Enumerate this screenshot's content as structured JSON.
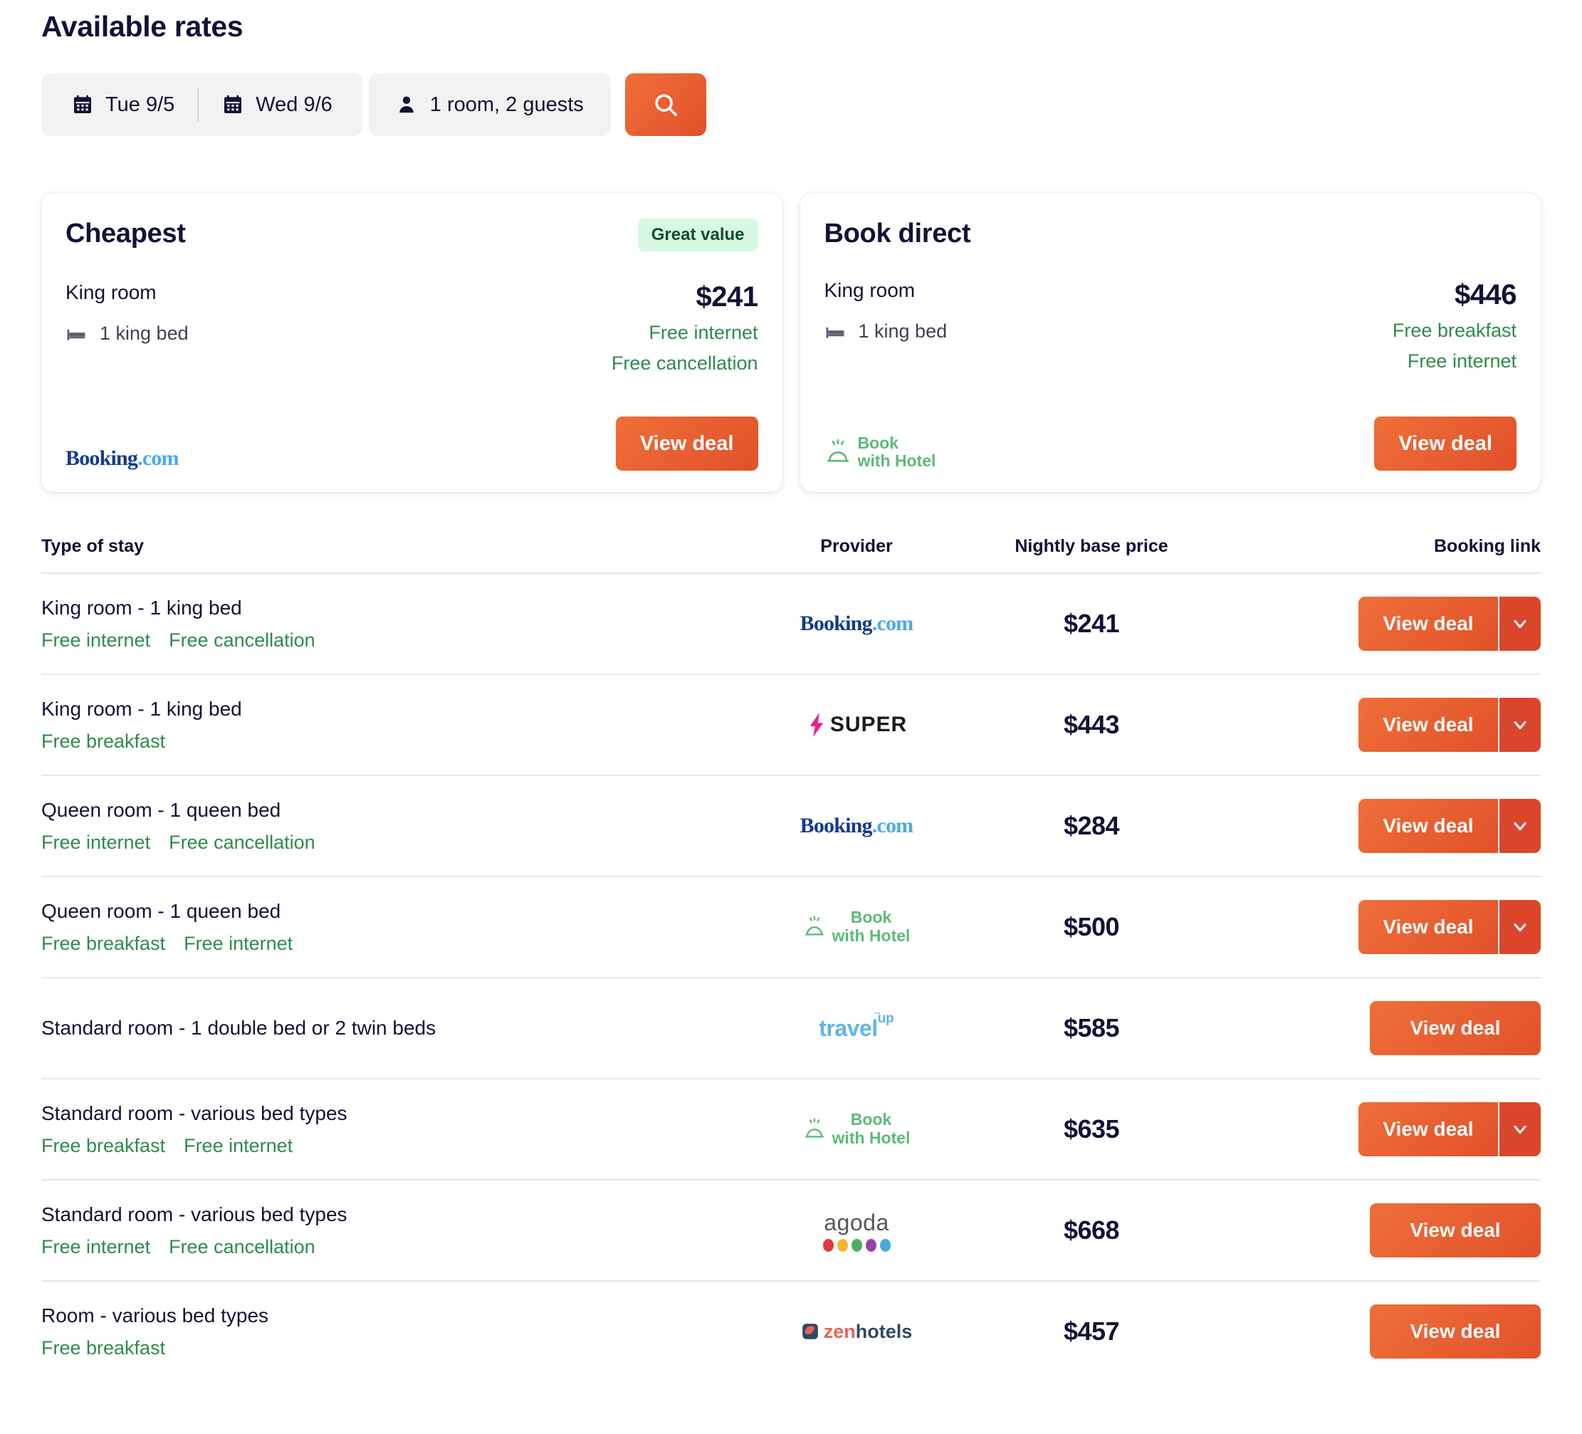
{
  "header": {
    "title": "Available rates"
  },
  "search": {
    "check_in": "Tue 9/5",
    "check_out": "Wed 9/6",
    "occupancy": "1 room, 2 guests",
    "search_icon": "search-icon",
    "calendar_icon": "calendar-icon",
    "person_icon": "person-icon",
    "accent_color": "#e8552b"
  },
  "cards": [
    {
      "title": "Cheapest",
      "badge": "Great value",
      "room": "King room",
      "bed": "1 king bed",
      "price": "$241",
      "perks": [
        "Free internet",
        "Free cancellation"
      ],
      "provider": "Booking.com",
      "cta": "View deal"
    },
    {
      "title": "Book direct",
      "badge": "",
      "room": "King room",
      "bed": "1 king bed",
      "price": "$446",
      "perks": [
        "Free breakfast",
        "Free internet"
      ],
      "provider": "Book with Hotel",
      "cta": "View deal"
    }
  ],
  "table": {
    "columns": [
      "Type of stay",
      "Provider",
      "Nightly base price",
      "Booking link"
    ],
    "cta_label": "View deal",
    "rows": [
      {
        "type": "King room - 1 king bed",
        "perks": [
          "Free internet",
          "Free cancellation"
        ],
        "provider": "Booking.com",
        "provider_key": "booking",
        "price": "$241",
        "has_dropdown": true
      },
      {
        "type": "King room - 1 king bed",
        "perks": [
          "Free breakfast"
        ],
        "provider": "SUPER",
        "provider_key": "super",
        "price": "$443",
        "has_dropdown": true
      },
      {
        "type": "Queen room - 1 queen bed",
        "perks": [
          "Free internet",
          "Free cancellation"
        ],
        "provider": "Booking.com",
        "provider_key": "booking",
        "price": "$284",
        "has_dropdown": true
      },
      {
        "type": "Queen room - 1 queen bed",
        "perks": [
          "Free breakfast",
          "Free internet"
        ],
        "provider": "Book with Hotel",
        "provider_key": "bwh",
        "price": "$500",
        "has_dropdown": true
      },
      {
        "type": "Standard room - 1 double bed or 2 twin beds",
        "perks": [],
        "provider": "travelup",
        "provider_key": "travelup",
        "price": "$585",
        "has_dropdown": false
      },
      {
        "type": "Standard room - various bed types",
        "perks": [
          "Free breakfast",
          "Free internet"
        ],
        "provider": "Book with Hotel",
        "provider_key": "bwh",
        "price": "$635",
        "has_dropdown": true
      },
      {
        "type": "Standard room - various bed types",
        "perks": [
          "Free internet",
          "Free cancellation"
        ],
        "provider": "agoda",
        "provider_key": "agoda",
        "price": "$668",
        "has_dropdown": false
      },
      {
        "type": "Room - various bed types",
        "perks": [
          "Free breakfast"
        ],
        "provider": "zenhotels",
        "provider_key": "zen",
        "price": "$457",
        "has_dropdown": false
      }
    ]
  },
  "logos": {
    "booking": {
      "part1": "Booking",
      "part2": ".com"
    },
    "bwh": {
      "line1": "Book",
      "line2": "with Hotel"
    },
    "super": {
      "text": "SUPER"
    },
    "travelup": {
      "part1": "travel",
      "part2": "up"
    },
    "agoda": {
      "text": "agoda",
      "dot_colors": [
        "#e2383f",
        "#f5b52e",
        "#4aad62",
        "#9b3fa5",
        "#4fa7e0"
      ]
    },
    "zen": {
      "part1": "zen",
      "part2": "hotels"
    }
  }
}
